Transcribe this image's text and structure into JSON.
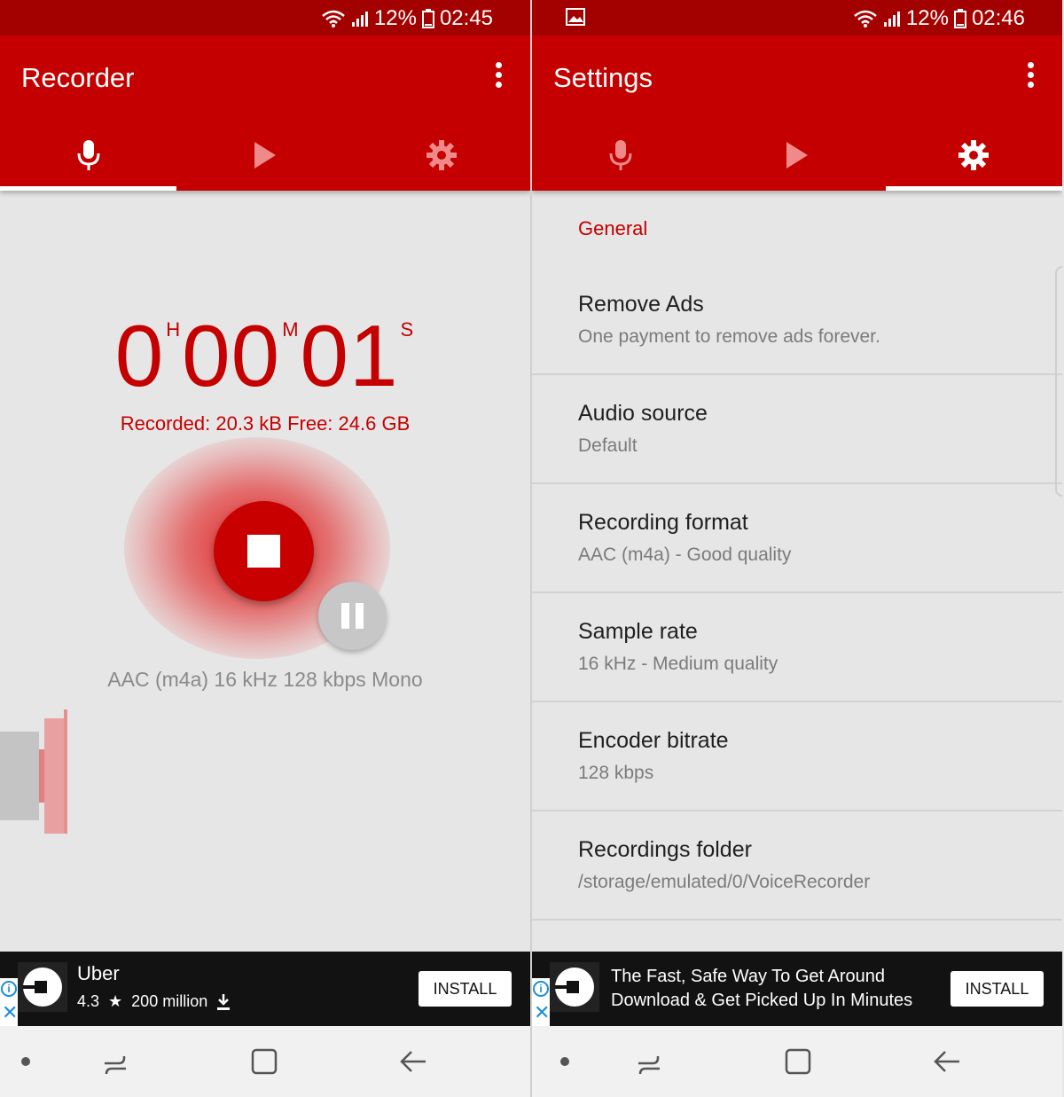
{
  "left": {
    "status": {
      "battery": "12%",
      "time": "02:45"
    },
    "app_title": "Recorder",
    "timer": {
      "hours": "0",
      "hours_unit": "H",
      "minutes": "00",
      "minutes_unit": "M",
      "seconds": "01",
      "seconds_unit": "S"
    },
    "recorded_info": "Recorded: 20.3 kB Free: 24.6 GB",
    "format_line": "AAC (m4a) 16 kHz 128 kbps Mono",
    "ad": {
      "title": "Uber",
      "rating": "4.3",
      "downloads": "200 million",
      "install": "INSTALL"
    }
  },
  "right": {
    "status": {
      "battery": "12%",
      "time": "02:46"
    },
    "app_title": "Settings",
    "section": "General",
    "settings": [
      {
        "title": "Remove Ads",
        "subtitle": "One payment to remove ads forever."
      },
      {
        "title": "Audio source",
        "subtitle": "Default"
      },
      {
        "title": "Recording format",
        "subtitle": "AAC (m4a) - Good quality"
      },
      {
        "title": "Sample rate",
        "subtitle": "16 kHz - Medium quality"
      },
      {
        "title": "Encoder bitrate",
        "subtitle": "128 kbps"
      },
      {
        "title": "Recordings folder",
        "subtitle": "/storage/emulated/0/VoiceRecorder"
      }
    ],
    "ad": {
      "line1": "The Fast, Safe Way To Get Around",
      "line2": "Download & Get Picked Up In Minutes",
      "install": "INSTALL"
    }
  },
  "colors": {
    "brand": "#c40000",
    "status_bar": "#a30000",
    "background": "#e6e6e6"
  },
  "icons": [
    "wifi-icon",
    "signal-icon",
    "battery-icon",
    "gallery-icon",
    "more-vert-icon",
    "mic-icon",
    "play-icon",
    "settings-gear-icon",
    "stop-icon",
    "pause-icon",
    "star-icon",
    "download-icon",
    "ad-info-icon",
    "ad-close-icon",
    "recents-icon",
    "home-icon",
    "back-icon"
  ]
}
